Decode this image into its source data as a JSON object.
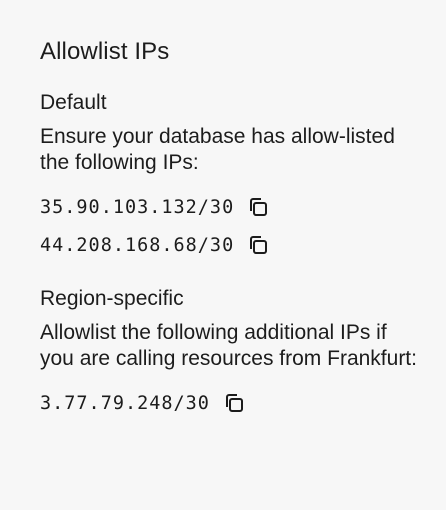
{
  "panel": {
    "title": "Allowlist IPs"
  },
  "default_section": {
    "title": "Default",
    "description": "Ensure your database has allow-listed the following IPs:",
    "ips": [
      "35.90.103.132/30",
      "44.208.168.68/30"
    ]
  },
  "region_section": {
    "title": "Region-specific",
    "description": "Allowlist the following additional IPs if you are calling resources from Frankfurt:",
    "ips": [
      "3.77.79.248/30"
    ]
  },
  "icons": {
    "copy": "copy-icon"
  }
}
